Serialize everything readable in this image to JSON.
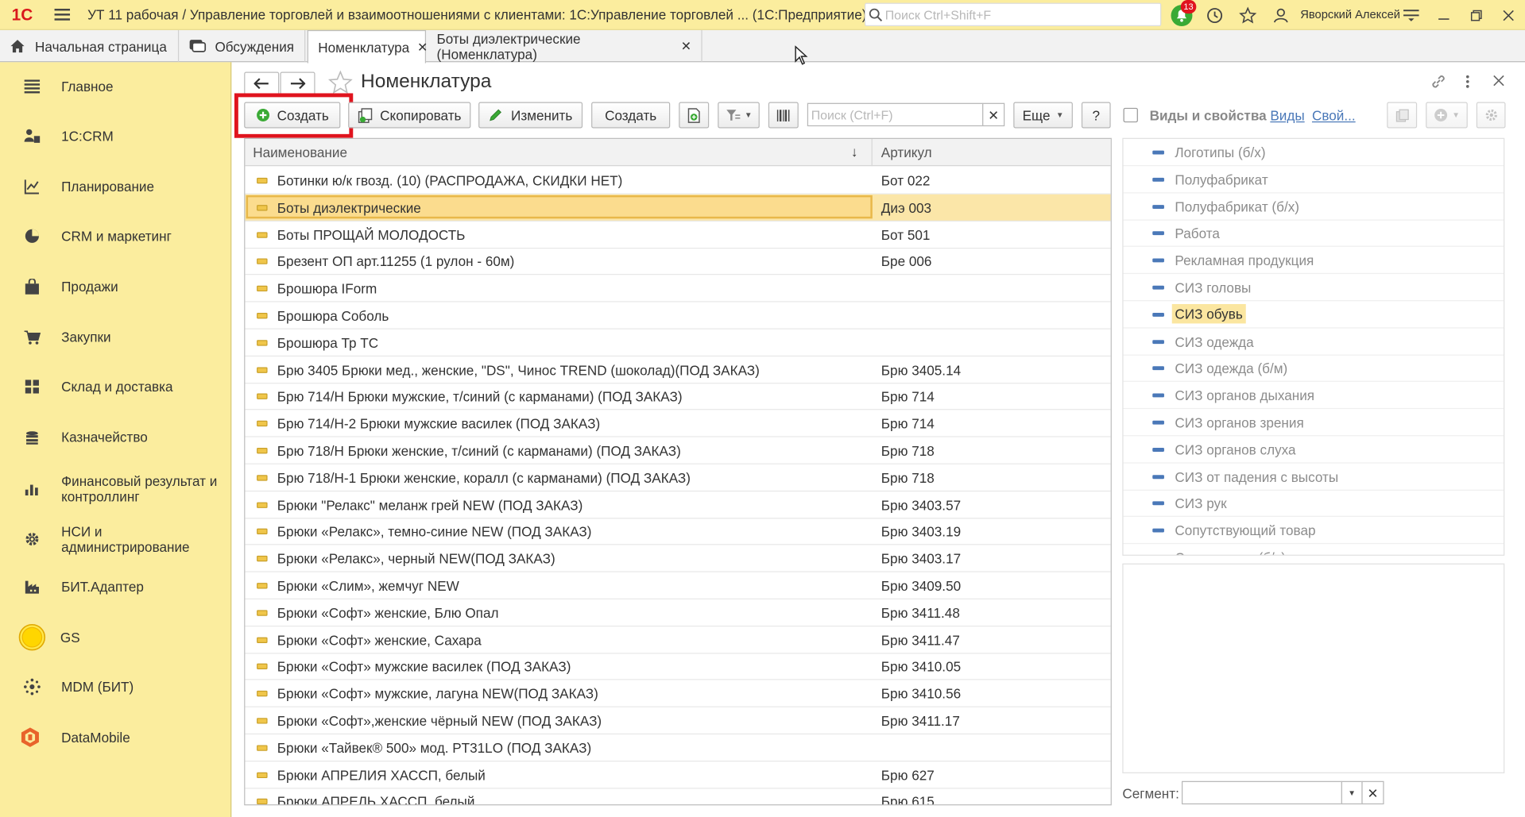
{
  "titlebar": {
    "logo": "1С",
    "title": "УТ 11 рабочая / Управление торговлей и взаимоотношениями с клиентами: 1С:Управление торговлей ... (1С:Предприятие)",
    "search_placeholder": "Поиск Ctrl+Shift+F",
    "notifications_count": "13",
    "user": "Яворский Алексей"
  },
  "tabs": [
    {
      "label": "Начальная страница"
    },
    {
      "label": "Обсуждения"
    },
    {
      "label": "Номенклатура"
    },
    {
      "label": "Боты диэлектрические (Номенклатура)"
    }
  ],
  "sidebar": {
    "items": [
      {
        "label": "Главное",
        "icon": "menu-icon"
      },
      {
        "label": "1С:CRM",
        "icon": "crm-icon"
      },
      {
        "label": "Планирование",
        "icon": "planning-icon"
      },
      {
        "label": "CRM и маркетинг",
        "icon": "pie-chart-icon"
      },
      {
        "label": "Продажи",
        "icon": "bag-icon"
      },
      {
        "label": "Закупки",
        "icon": "cart-icon"
      },
      {
        "label": "Склад и доставка",
        "icon": "warehouse-icon"
      },
      {
        "label": "Казначейство",
        "icon": "coins-icon"
      },
      {
        "label": "Финансовый результат и контроллинг",
        "icon": "bar-chart-icon"
      },
      {
        "label": "НСИ и администрирование",
        "icon": "gear-icon"
      },
      {
        "label": "БИТ.Адаптер",
        "icon": "factory-icon"
      },
      {
        "label": "GS",
        "icon": "sun-icon"
      },
      {
        "label": "MDM (БИТ)",
        "icon": "network-icon"
      },
      {
        "label": "DataMobile",
        "icon": "datamobile-icon"
      }
    ]
  },
  "form": {
    "title": "Номенклатура",
    "toolbar": {
      "create": "Создать",
      "copy": "Скопировать",
      "edit": "Изменить",
      "create2": "Создать",
      "search_placeholder": "Поиск (Ctrl+F)",
      "more": "Еще",
      "help": "?"
    },
    "columns": {
      "name": "Наименование",
      "code": "Артикул"
    },
    "rows": [
      {
        "name": "Ботинки ю/к гвозд. (10) (РАСПРОДАЖА, СКИДКИ НЕТ)",
        "code": "Бот 022"
      },
      {
        "name": "Боты диэлектрические",
        "code": "Диэ 003"
      },
      {
        "name": "Боты ПРОЩАЙ МОЛОДОСТЬ",
        "code": "Бот 501"
      },
      {
        "name": "Брезент ОП арт.11255 (1 рулон - 60м)",
        "code": "Бре 006"
      },
      {
        "name": "Брошюра IForm",
        "code": ""
      },
      {
        "name": "Брошюра Соболь",
        "code": ""
      },
      {
        "name": "Брошюра Тр ТС",
        "code": ""
      },
      {
        "name": "Брю 3405 Брюки мед., женские, \"DS\", Чинос TREND (шоколад)(ПОД ЗАКАЗ)",
        "code": "Брю 3405.14"
      },
      {
        "name": "Брю 714/Н Брюки мужские, т/синий (с карманами) (ПОД ЗАКАЗ)",
        "code": "Брю 714"
      },
      {
        "name": "Брю 714/Н-2 Брюки мужские василек (ПОД ЗАКАЗ)",
        "code": "Брю 714"
      },
      {
        "name": "Брю 718/Н Брюки женские, т/синий (с карманами) (ПОД ЗАКАЗ)",
        "code": "Брю 718"
      },
      {
        "name": "Брю 718/Н-1 Брюки женские, коралл (с карманами) (ПОД ЗАКАЗ)",
        "code": "Брю 718"
      },
      {
        "name": "Брюки \"Релакс\" меланж грей NEW (ПОД ЗАКАЗ)",
        "code": "Брю 3403.57"
      },
      {
        "name": "Брюки «Релакс», темно-синие NEW (ПОД ЗАКАЗ)",
        "code": "Брю 3403.19"
      },
      {
        "name": "Брюки «Релакс», черный NEW(ПОД ЗАКАЗ)",
        "code": "Брю 3403.17"
      },
      {
        "name": "Брюки «Слим», жемчуг NEW",
        "code": "Брю 3409.50"
      },
      {
        "name": "Брюки «Софт» женские, Блю Опал",
        "code": "Брю 3411.48"
      },
      {
        "name": "Брюки «Софт» женские, Сахара",
        "code": "Брю 3411.47"
      },
      {
        "name": "Брюки «Софт» мужские василек (ПОД ЗАКАЗ)",
        "code": "Брю 3410.05"
      },
      {
        "name": "Брюки «Софт» мужские, лагуна NEW(ПОД ЗАКАЗ)",
        "code": "Брю 3410.56"
      },
      {
        "name": "Брюки «Софт»,женские чёрный NEW (ПОД ЗАКАЗ)",
        "code": "Брю 3411.17"
      },
      {
        "name": "Брюки «Тайвек® 500» мод. PT31LO (ПОД ЗАКАЗ)",
        "code": ""
      },
      {
        "name": "Брюки АПРЕЛИЯ ХАССП, белый",
        "code": "Брю 627"
      },
      {
        "name": "Брюки АПРЕЛЬ ХАССП, белый",
        "code": "Брю 615"
      }
    ]
  },
  "right_panel": {
    "checkbox_label": "Виды и свойства",
    "link_kinds": "Виды",
    "link_props": "Свой...",
    "items": [
      "Логотипы (б/х)",
      "Полуфабрикат",
      "Полуфабрикат (б/х)",
      "Работа",
      "Рекламная продукция",
      "СИЗ головы",
      "СИЗ обувь",
      "СИЗ одежда",
      "СИЗ одежда (б/м)",
      "СИЗ органов дыхания",
      "СИЗ органов зрения",
      "СИЗ органов слуха",
      "СИЗ от падения с высоты",
      "СИЗ рук",
      "Сопутствующий товар",
      "Спецодежда (б/х)"
    ],
    "selected_item": "СИЗ обувь",
    "segment_label": "Сегмент:",
    "segment_value": ""
  },
  "colors": {
    "accent_yellow": "#fbed9e",
    "selection": "#fbdc8e",
    "highlight_red": "#e0141e",
    "link_blue": "#4a78b8"
  }
}
